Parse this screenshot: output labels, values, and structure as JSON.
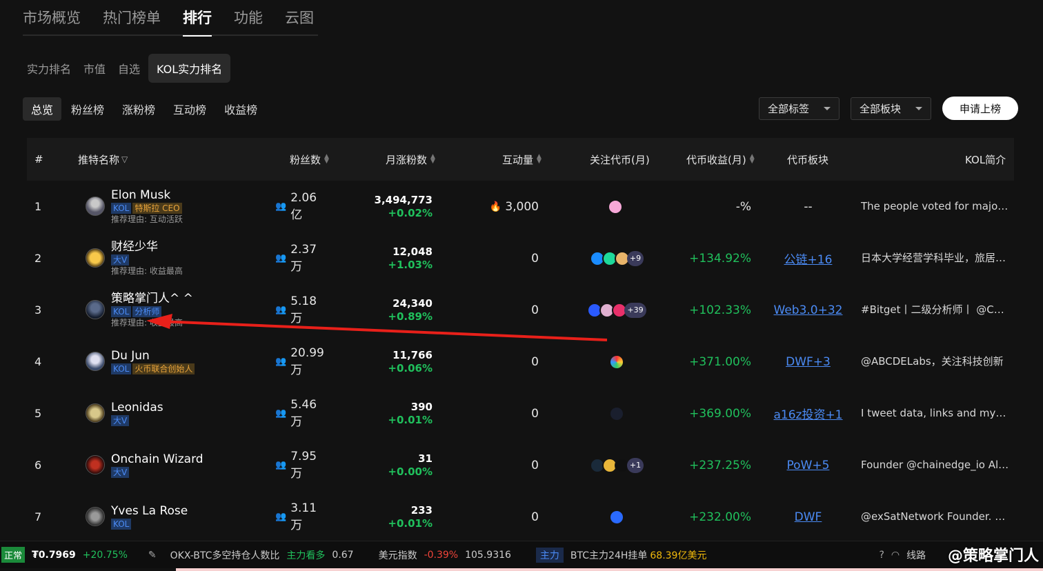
{
  "top_tabs": [
    "市场概览",
    "热门榜单",
    "排行",
    "功能",
    "云图"
  ],
  "sub_tabs": [
    "实力排名",
    "市值",
    "自选",
    "KOL实力排名"
  ],
  "rank_tabs": [
    "总览",
    "粉丝榜",
    "涨粉榜",
    "互动榜",
    "收益榜"
  ],
  "filters": {
    "tags": "全部标签",
    "sectors": "全部板块",
    "apply": "申请上榜"
  },
  "headers": {
    "rank": "#",
    "name": "推特名称",
    "followers": "粉丝数",
    "growth": "月涨粉数",
    "interact": "互动量",
    "coins": "关注代币(月)",
    "profit": "代币收益(月)",
    "sector": "代币板块",
    "intro": "KOL简介"
  },
  "rows": [
    {
      "rank": "1",
      "name": "Elon Musk",
      "tags": [
        "KOL",
        "特斯拉 CEO"
      ],
      "reason": "推荐理由: 互动活跃",
      "followers": "2.06亿",
      "growth": "3,494,773",
      "growth_pct": "+0.02%",
      "interact": "3,000",
      "coins_more": "",
      "profit": "-%",
      "sector": "--",
      "intro": "The people voted for major reform"
    },
    {
      "rank": "2",
      "name": "财经少华",
      "tags": [
        "大V"
      ],
      "reason": "推荐理由: 收益最高",
      "followers": "2.37万",
      "growth": "12,048",
      "growth_pct": "+1.03%",
      "interact": "0",
      "coins_more": "+9",
      "profit": "+134.92%",
      "sector": "公链+16",
      "intro": "日本大学经营学科毕业，旅居日本"
    },
    {
      "rank": "3",
      "name": "策略掌门人^ ^",
      "tags": [
        "KOL",
        "分析师"
      ],
      "reason": "推荐理由: 收益最高",
      "followers": "5.18万",
      "growth": "24,340",
      "growth_pct": "+0.89%",
      "interact": "0",
      "coins_more": "+39",
      "profit": "+102.33%",
      "sector": "Web3.0+32",
      "intro": "#Bitget丨二级分析师丨 @Coinw"
    },
    {
      "rank": "4",
      "name": "Du Jun",
      "tags": [
        "KOL",
        "火币联合创始人"
      ],
      "reason": "",
      "followers": "20.99万",
      "growth": "11,766",
      "growth_pct": "+0.06%",
      "interact": "0",
      "coins_more": "",
      "profit": "+371.00%",
      "sector": "DWF+3",
      "intro": "@ABCDELabs，关注科技创新"
    },
    {
      "rank": "5",
      "name": "Leonidas",
      "tags": [
        "大V"
      ],
      "reason": "",
      "followers": "5.46万",
      "growth": "390",
      "growth_pct": "+0.01%",
      "interact": "0",
      "coins_more": "",
      "profit": "+369.00%",
      "sector": "a16z投资+1",
      "intro": "I tweet data, links and my opinions"
    },
    {
      "rank": "6",
      "name": "Onchain Wizard",
      "tags": [
        "大V"
      ],
      "reason": "",
      "followers": "7.95万",
      "growth": "31",
      "growth_pct": "+0.00%",
      "interact": "0",
      "coins_more": "+1",
      "profit": "+237.25%",
      "sector": "PoW+5",
      "intro": "Founder @chainedge_io Alpha"
    },
    {
      "rank": "7",
      "name": "Yves La Rose",
      "tags": [
        "KOL"
      ],
      "reason": "",
      "followers": "3.11万",
      "growth": "233",
      "growth_pct": "+0.01%",
      "interact": "0",
      "coins_more": "",
      "profit": "+232.00%",
      "sector": "DWF",
      "intro": "@exSatNetwork Founder. CEO"
    }
  ],
  "ticker": {
    "status": "正常",
    "price": "₮0.7969",
    "price_change": "+20.75%",
    "okx_label": "OKX-BTC多空持仓人数比",
    "okx_signal": "主力看多",
    "okx_value": "0.67",
    "usd_label": "美元指数",
    "usd_change": "-0.39%",
    "usd_value": "105.9316",
    "main_tag": "主力",
    "btc_label": "BTC主力24H挂单",
    "btc_value": "68.39亿美元",
    "line_label": "线路"
  },
  "watermark": "@策略掌门人"
}
